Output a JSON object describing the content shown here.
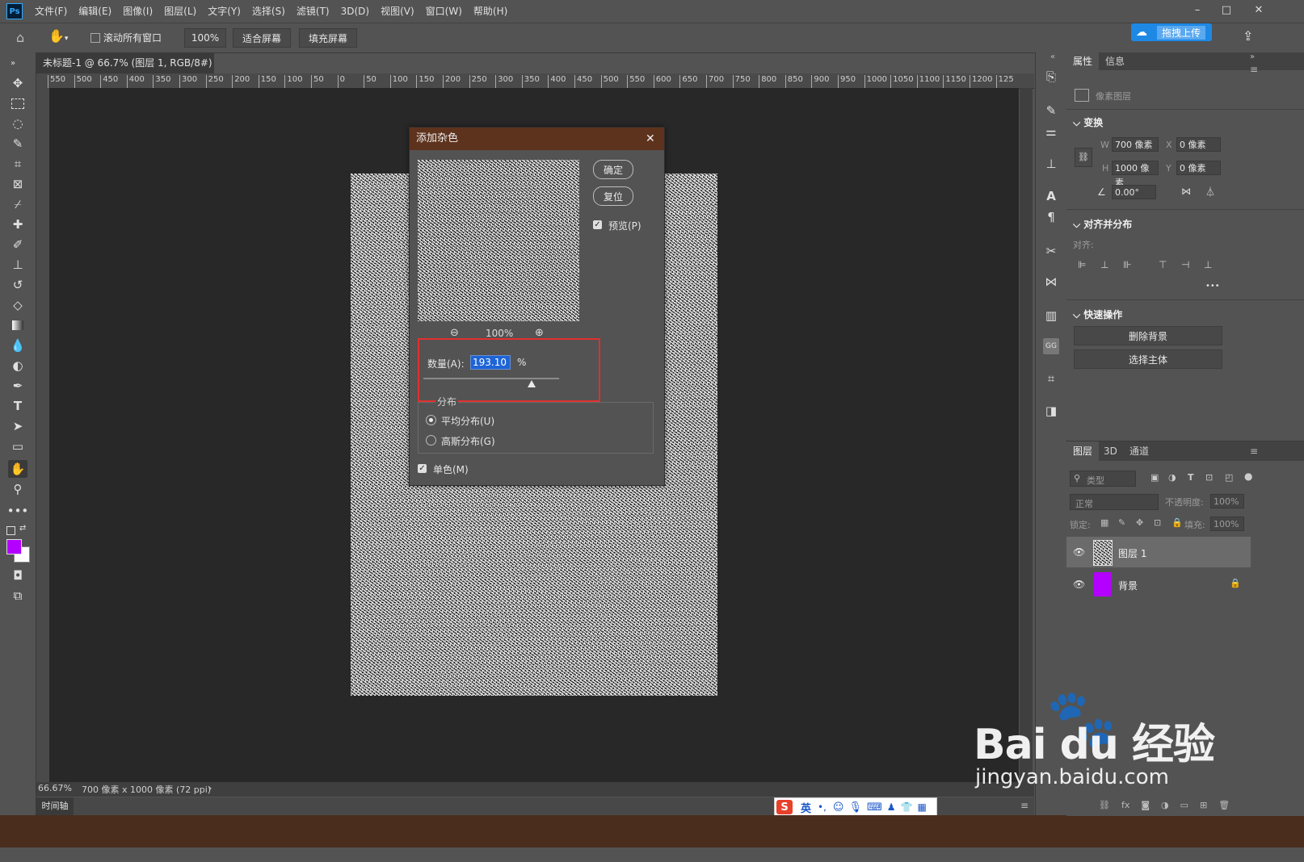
{
  "menubar": {
    "logo": "Ps",
    "items": [
      "文件(F)",
      "编辑(E)",
      "图像(I)",
      "图层(L)",
      "文字(Y)",
      "选择(S)",
      "滤镜(T)",
      "3D(D)",
      "视图(V)",
      "窗口(W)",
      "帮助(H)"
    ],
    "minimize": "–",
    "restore": "□",
    "close": "✕"
  },
  "options": {
    "scroll_all_label": "滚动所有窗口",
    "zoom_value": "100%",
    "fit_screen": "适合屏幕",
    "fill_screen": "填充屏幕",
    "upload_label": "拖拽上传"
  },
  "document": {
    "tab_title": "未标题-1 @ 66.7% (图层 1, RGB/8#) *",
    "tab_close": "×",
    "ruler_top": [
      "550",
      "500",
      "450",
      "400",
      "350",
      "300",
      "250",
      "200",
      "150",
      "100",
      "50",
      "0",
      "50",
      "100",
      "150",
      "200",
      "250",
      "300",
      "350",
      "400",
      "450",
      "500",
      "550",
      "600",
      "650",
      "700",
      "750",
      "800",
      "850",
      "900",
      "950",
      "1000",
      "1050",
      "1100",
      "1150",
      "1200",
      "125"
    ],
    "status_zoom": "66.67%",
    "status_info": "700 像素 x 1000 像素 (72 ppi)",
    "status_arrow": "›",
    "timeline_label": "时间轴"
  },
  "dialog": {
    "title": "添加杂色",
    "close": "✕",
    "ok": "确定",
    "reset": "复位",
    "preview_label": "预览(P)",
    "preview_checked": true,
    "preview_zoom": "100%",
    "amount_label": "数量(A):",
    "amount_value": "193.10",
    "amount_unit": "%",
    "amount_slider_fraction": 0.8,
    "distribution_label": "分布",
    "uniform_label": "平均分布(U)",
    "gaussian_label": "高斯分布(G)",
    "selected_distribution": "uniform",
    "mono_label": "单色(M)",
    "mono_checked": true,
    "highlight_color": "#e0302f"
  },
  "properties": {
    "tabs": [
      "属性",
      "信息"
    ],
    "layer_type": "像素图层",
    "transform_title": "变换",
    "w_label": "W",
    "w_value": "700 像素",
    "x_label": "X",
    "x_value": "0 像素",
    "h_label": "H",
    "h_value": "1000 像素",
    "y_label": "Y",
    "y_value": "0 像素",
    "angle_value": "0.00°",
    "align_title": "对齐并分布",
    "align_label": "对齐:",
    "more": "•••",
    "quick_title": "快速操作",
    "remove_bg": "删除背景",
    "select_subject": "选择主体"
  },
  "layers": {
    "tabs": [
      "图层",
      "3D",
      "通道"
    ],
    "filter_placeholder": "类型",
    "blend_mode": "正常",
    "opacity_label": "不透明度:",
    "opacity_value": "100%",
    "lock_label": "锁定:",
    "fill_label": "填充:",
    "fill_value": "100%",
    "items": [
      {
        "name": "图层 1"
      },
      {
        "name": "背景"
      }
    ],
    "background_color": "#b400ff"
  },
  "colors": {
    "foreground": "#b400ff",
    "background": "#ffffff"
  },
  "ime": {
    "lang": "英"
  },
  "watermark": {
    "brand": "Bai du 经验",
    "url": "jingyan.baidu.com"
  }
}
